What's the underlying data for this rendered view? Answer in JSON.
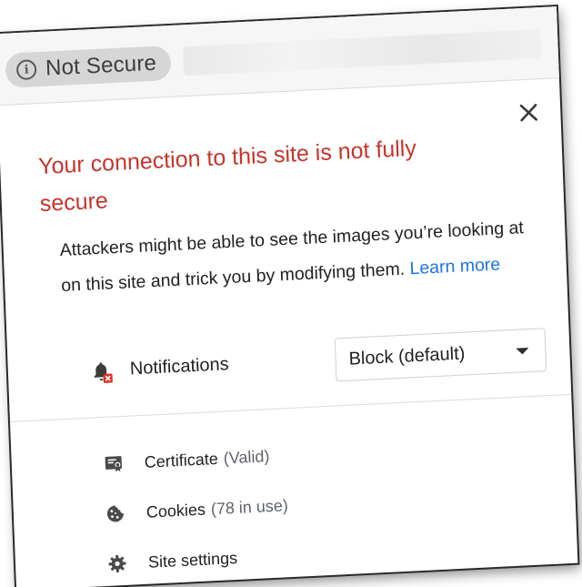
{
  "chip": {
    "icon": "info-circle-icon",
    "label": "Not Secure"
  },
  "close": {
    "icon": "close-icon"
  },
  "heading": "Your connection to this site is not fully secure",
  "description": {
    "text": "Attackers might be able to see the images you’re looking at on this site and trick you by modifying them.",
    "link": "Learn more"
  },
  "permissions": {
    "notifications": {
      "icon": "notifications-blocked-icon",
      "label": "Notifications",
      "value": "Block (default)"
    }
  },
  "menu": {
    "certificate": {
      "icon": "certificate-icon",
      "label": "Certificate",
      "sub": "(Valid)"
    },
    "cookies": {
      "icon": "cookie-icon",
      "label": "Cookies",
      "sub": "(78 in use)"
    },
    "site_settings": {
      "icon": "gear-icon",
      "label": "Site settings"
    }
  },
  "colors": {
    "warning": "#c5352b",
    "link": "#1a73e8",
    "chip_bg": "#d6d6d6"
  }
}
